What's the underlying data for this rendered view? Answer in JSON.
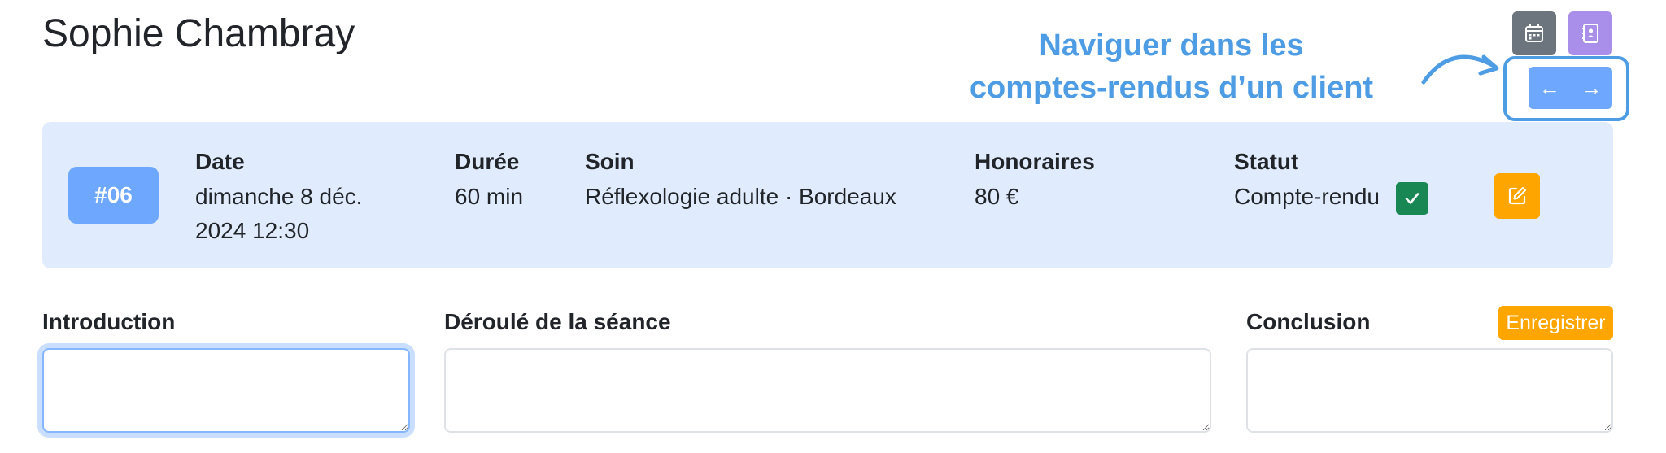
{
  "client": {
    "name": "Sophie Chambray"
  },
  "annotation": {
    "line1": "Naviguer dans les",
    "line2": "comptes-rendus d’un client"
  },
  "nav": {
    "prev_icon": "←",
    "next_icon": "→"
  },
  "toolbar": {
    "calendar_icon": "calendar-icon",
    "contact_icon": "contact-book-icon"
  },
  "seance": {
    "number": "#06",
    "date": {
      "label": "Date",
      "line1": "dimanche 8 déc.",
      "line2": "2024 12:30"
    },
    "duree": {
      "label": "Durée",
      "value": "60 min"
    },
    "soin": {
      "label": "Soin",
      "value": "Réflexologie adulte · Bordeaux"
    },
    "honoraires": {
      "label": "Honoraires",
      "value": "80 €"
    },
    "statut": {
      "label": "Statut",
      "value": "Compte-rendu",
      "checked": true
    }
  },
  "form": {
    "introduction": {
      "label": "Introduction",
      "value": ""
    },
    "deroule": {
      "label": "Déroulé de la séance",
      "value": ""
    },
    "conclusion": {
      "label": "Conclusion",
      "value": ""
    },
    "save_label": "Enregistrer"
  },
  "colors": {
    "accent_blue": "#6ea8fe",
    "card_bg": "#e0ebfd",
    "annotation_blue": "#4d9ce4",
    "warning_orange": "#ffa500",
    "success_green": "#198754",
    "secondary_gray": "#6c757d",
    "purple": "#a98eea"
  }
}
